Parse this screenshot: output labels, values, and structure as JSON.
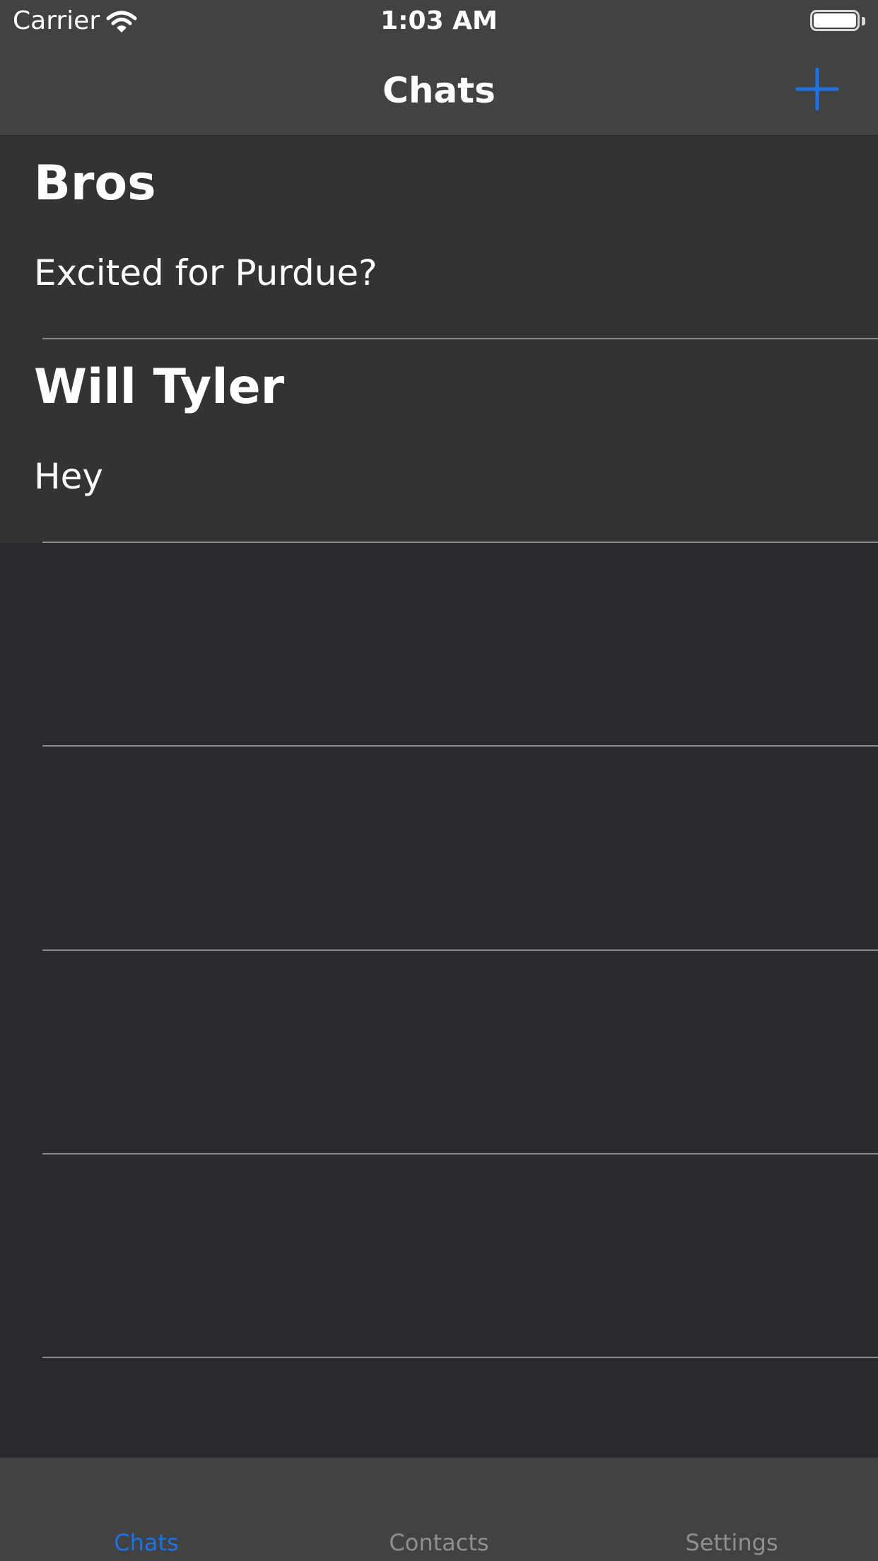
{
  "status_bar": {
    "carrier": "Carrier",
    "time": "1:03 AM",
    "wifi_icon": "wifi-icon",
    "battery_icon": "battery-icon"
  },
  "nav": {
    "title": "Chats",
    "add_icon": "plus-icon"
  },
  "chats": [
    {
      "name": "Bros",
      "preview": "Excited for Purdue?"
    },
    {
      "name": "Will Tyler",
      "preview": "Hey"
    }
  ],
  "tabs": [
    {
      "label": "Chats",
      "active": true
    },
    {
      "label": "Contacts",
      "active": false
    },
    {
      "label": "Settings",
      "active": false
    }
  ],
  "colors": {
    "accent": "#1a73e8",
    "bar_background": "#424242",
    "row_background": "#333333",
    "list_background": "#2a2b2f",
    "separator": "#8a8a8c"
  }
}
